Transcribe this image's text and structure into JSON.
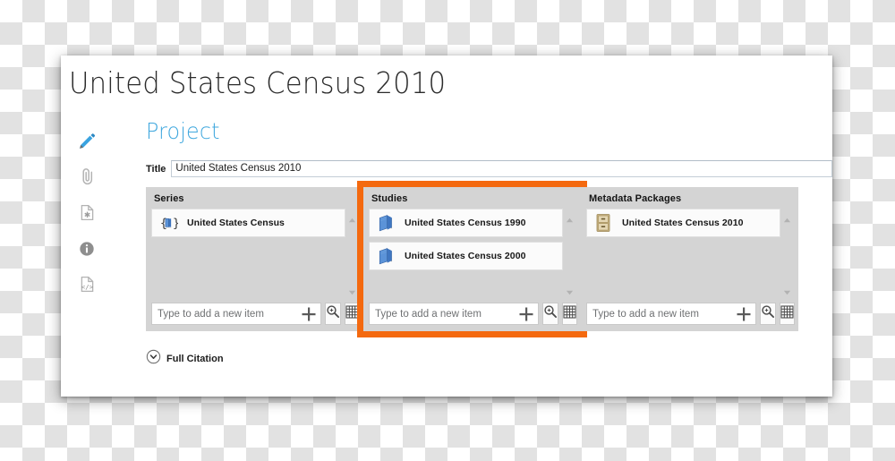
{
  "window": {
    "page_title": "United States Census 2010",
    "section_heading": "Project"
  },
  "icon_rail": {
    "items": [
      {
        "name": "pencil-icon",
        "label": "Edit",
        "active": true
      },
      {
        "name": "paperclip-icon",
        "label": "Attachments",
        "active": false
      },
      {
        "name": "document-new-icon",
        "label": "New Document",
        "active": false
      },
      {
        "name": "info-icon",
        "label": "Information",
        "active": false
      },
      {
        "name": "document-code-icon",
        "label": "Source",
        "active": false
      }
    ]
  },
  "title_field": {
    "label": "Title",
    "value": "United States Census 2010",
    "placeholder": ""
  },
  "panels": [
    {
      "id": "series",
      "title": "Series",
      "highlighted": false,
      "items": [
        {
          "label": "United States Census",
          "icon": "braced-book-icon"
        }
      ],
      "add_placeholder": "Type to add a new item",
      "add_value": "",
      "buttons": {
        "plus": "+",
        "search": "magnifier-plus-icon",
        "grid": "grid-icon"
      }
    },
    {
      "id": "studies",
      "title": "Studies",
      "highlighted": true,
      "items": [
        {
          "label": "United States Census 1990",
          "icon": "blue-book-icon"
        },
        {
          "label": "United States Census 2000",
          "icon": "blue-book-icon"
        }
      ],
      "add_placeholder": "Type to add a new item",
      "add_value": "",
      "buttons": {
        "plus": "+",
        "search": "magnifier-plus-icon",
        "grid": "grid-icon"
      }
    },
    {
      "id": "metadata-packages",
      "title": "Metadata Packages",
      "highlighted": false,
      "items": [
        {
          "label": "United States Census 2010",
          "icon": "file-cabinet-icon"
        }
      ],
      "add_placeholder": "Type to add a new item",
      "add_value": "",
      "buttons": {
        "plus": "+",
        "search": "magnifier-plus-icon",
        "grid": "grid-icon"
      }
    }
  ],
  "full_citation": {
    "label": "Full Citation",
    "icon": "chevron-down-circle-icon",
    "expanded": false
  },
  "colors": {
    "accent_heading": "#41a8de",
    "highlight_border": "#f4690f",
    "panel_background": "#d4d4d4",
    "window_background": "#ffffff"
  }
}
